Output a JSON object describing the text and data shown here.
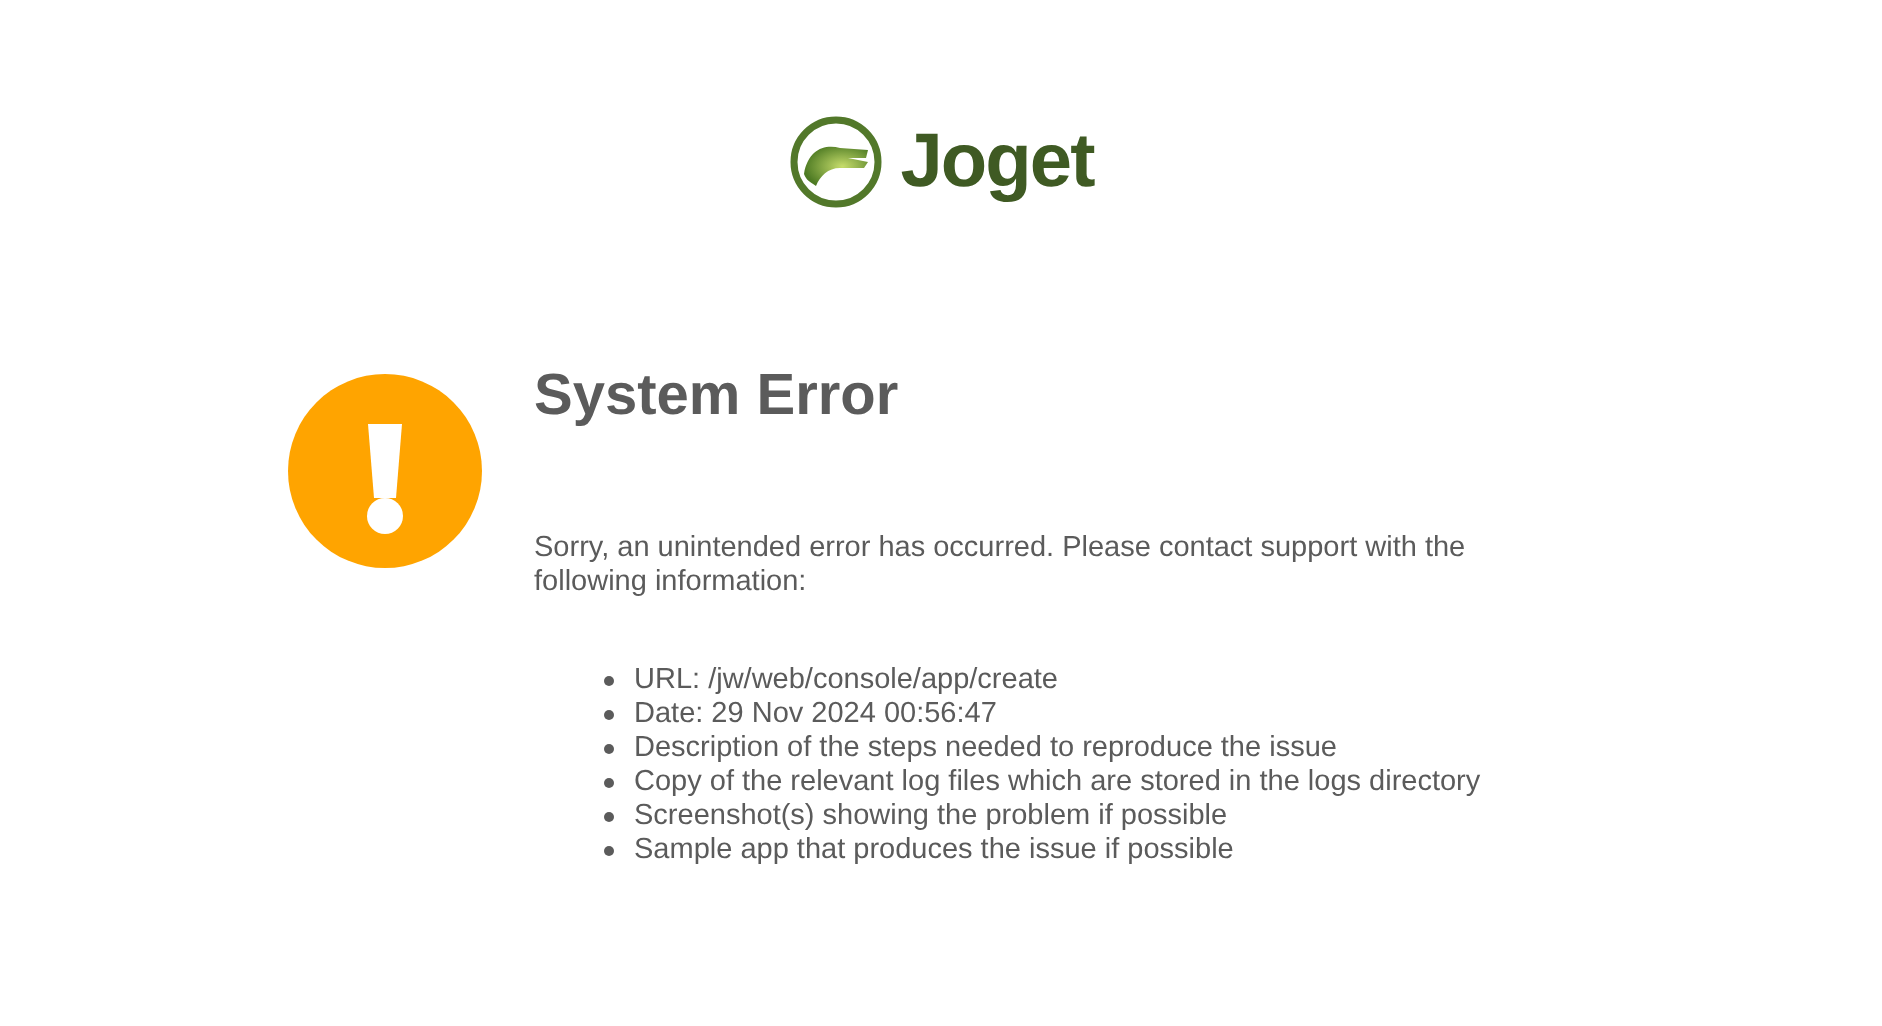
{
  "logo": {
    "name": "Joget"
  },
  "error": {
    "title": "System Error",
    "message": "Sorry, an unintended error has occurred. Please contact support with the following information:",
    "items": [
      "URL: /jw/web/console/app/create",
      "Date: 29 Nov 2024 00:56:47",
      "Description of the steps needed to reproduce the issue",
      "Copy of the relevant log files which are stored in the logs directory",
      "Screenshot(s) showing the problem if possible",
      "Sample app that produces the issue if possible"
    ]
  }
}
